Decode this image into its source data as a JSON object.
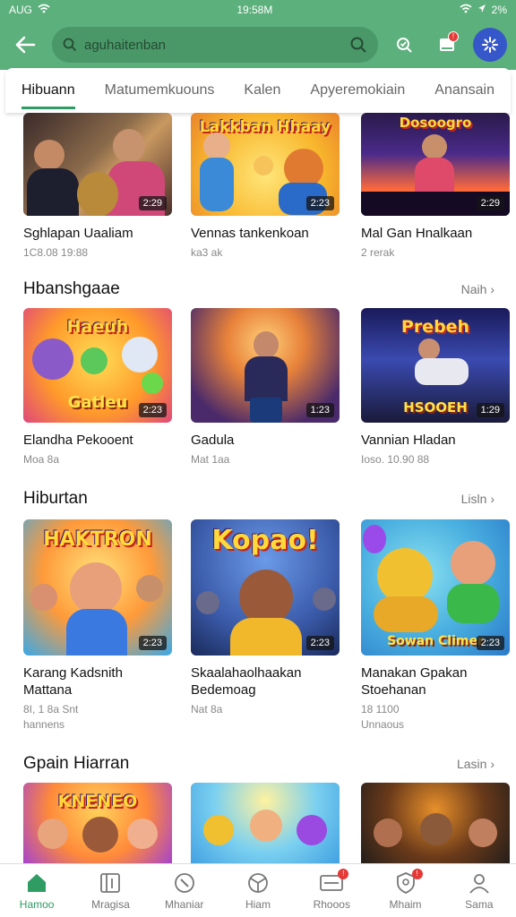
{
  "status": {
    "carrier": "AUG",
    "time": "19:58M",
    "battery": "2%"
  },
  "search": {
    "placeholder": "aguhaitenban"
  },
  "tabs": [
    {
      "label": "Hibuann",
      "active": true
    },
    {
      "label": "Matumemkuouns",
      "active": false
    },
    {
      "label": "Kalen",
      "active": false
    },
    {
      "label": "Apyeremokiain",
      "active": false
    },
    {
      "label": "Anansain",
      "active": false
    }
  ],
  "row0": {
    "cards": [
      {
        "title": "Sghlapan Uaaliam",
        "meta": "1C8.08 19:88",
        "badge": "2:29",
        "art": ""
      },
      {
        "title": "Vennas tankenkoan",
        "meta": "ka3 ak",
        "badge": "2:23",
        "art": "Lakkban Hhaay"
      },
      {
        "title": "Mal Gan Hnalkaan",
        "meta": "2 rerak",
        "badge": "2:29",
        "art": "Dosoogro"
      }
    ]
  },
  "sections": [
    {
      "title": "Hbanshgaae",
      "more": "Naih",
      "cards": [
        {
          "title": "Elandha Pekooent",
          "meta": "Moa 8a",
          "badge": "2:23",
          "art": "Haeuh",
          "sub": "Gatleu"
        },
        {
          "title": "Gadula",
          "meta": "Mat 1aa",
          "badge": "1:23",
          "art": "",
          "sub": ""
        },
        {
          "title": "Vannian Hladan",
          "meta": "Ioso. 10.90 88",
          "badge": "1:29",
          "art": "Prebeh",
          "sub": "HSOOEH"
        }
      ]
    },
    {
      "title": "Hiburtan",
      "more": "Lisln",
      "cards": [
        {
          "title": "Karang Kadsnith Mattana",
          "meta": "8I, 1 8a Snt",
          "meta2": "hannens",
          "badge": "2:23",
          "art": "HAKTRON",
          "sub": ""
        },
        {
          "title": "Skaalahaolhaakan Bedemoag",
          "meta": "Nat 8a",
          "meta2": "",
          "badge": "2:23",
          "art": "Kopao!",
          "sub": ""
        },
        {
          "title": "Manakan Gpakan Stoehanan",
          "meta": "18 1100",
          "meta2": "Unnaous",
          "badge": "2:23",
          "art": "",
          "sub": "Sowan Climer"
        }
      ]
    },
    {
      "title": "Gpain Hiarran",
      "more": "Lasin",
      "cards": [
        {
          "art": "KNENEO"
        },
        {
          "art": ""
        },
        {
          "art": ""
        }
      ]
    }
  ],
  "bottom_nav": [
    {
      "label": "Hamoo",
      "icon": "home-icon",
      "active": true,
      "dot": ""
    },
    {
      "label": "Mragisa",
      "icon": "library-icon",
      "active": false,
      "dot": ""
    },
    {
      "label": "Mhaniar",
      "icon": "compass-icon",
      "active": false,
      "dot": ""
    },
    {
      "label": "Hiam",
      "icon": "wheel-icon",
      "active": false,
      "dot": ""
    },
    {
      "label": "Rhooos",
      "icon": "inbox-icon",
      "active": false,
      "dot": "!"
    },
    {
      "label": "Mhaim",
      "icon": "badge-icon",
      "active": false,
      "dot": "!"
    },
    {
      "label": "Sama",
      "icon": "profile-icon",
      "active": false,
      "dot": ""
    }
  ],
  "colors": {
    "brand": "#5cb07c",
    "accent": "#2e9c63"
  }
}
